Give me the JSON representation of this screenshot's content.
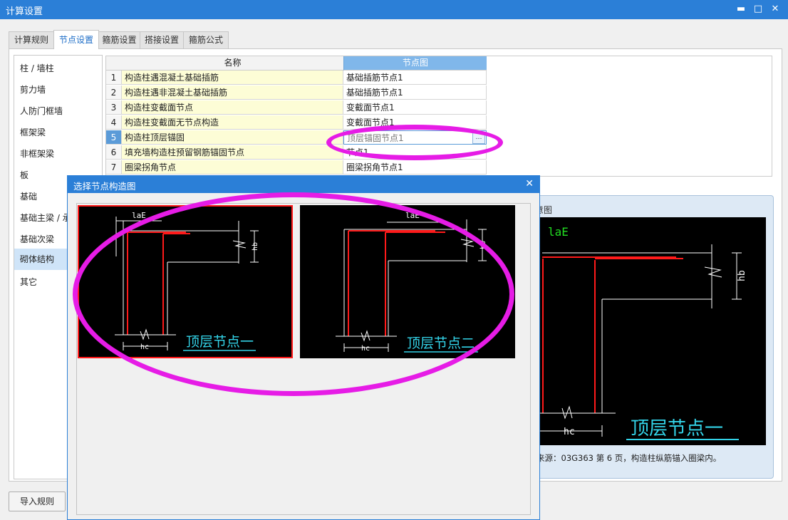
{
  "window": {
    "title": "计算设置",
    "minimize": "▬",
    "maximize": "□",
    "close": "✕"
  },
  "tabs": [
    "计算规则",
    "节点设置",
    "箍筋设置",
    "搭接设置",
    "箍筋公式"
  ],
  "active_tab": 1,
  "left_nav": [
    "柱 / 墙柱",
    "剪力墙",
    "人防门框墙",
    "框架梁",
    "非框架梁",
    "板",
    "基础",
    "基础主梁 / 承台梁",
    "基础次梁",
    "砌体结构",
    "其它"
  ],
  "selected_nav": 9,
  "grid": {
    "headers": {
      "name": "名称",
      "node": "节点图"
    },
    "rows": [
      {
        "no": "1",
        "name": "构造柱遇混凝土基础插筋",
        "node": "基础插筋节点1"
      },
      {
        "no": "2",
        "name": "构造柱遇非混凝土基础插筋",
        "node": "基础插筋节点1"
      },
      {
        "no": "3",
        "name": "构造柱变截面节点",
        "node": "变截面节点1"
      },
      {
        "no": "4",
        "name": "构造柱变截面无节点构造",
        "node": "变截面节点1"
      },
      {
        "no": "5",
        "name": "构造柱顶层锚固",
        "node": "顶层锚固节点1"
      },
      {
        "no": "6",
        "name": "填充墙构造柱预留钢筋锚固节点",
        "node": "节点1"
      },
      {
        "no": "7",
        "name": "圈梁拐角节点",
        "node": "圈梁拐角节点1"
      }
    ],
    "selected_row": 4,
    "ellipsis": "…"
  },
  "info_panel": {
    "title": "意图",
    "caption": "顶层节点一",
    "labels": {
      "lae": "laE",
      "hb": "hb",
      "hc": "hc"
    },
    "source": "来源：03G363 第 6 页，构造柱纵筋锚入圈梁内。"
  },
  "import_button": "导入规则",
  "dialog": {
    "title": "选择节点构造图",
    "close": "✕",
    "options": [
      {
        "caption": "顶层节点一",
        "selected": true
      },
      {
        "caption": "顶层节点二",
        "selected": false
      }
    ],
    "labels": {
      "lae": "laE",
      "hb": "hb",
      "hc": "hc"
    }
  },
  "colors": {
    "accent": "#2b7fd7",
    "highlight": "#e61ce6",
    "rebar": "#ff1a1a",
    "caption": "#33d3e8",
    "lae_big": "#22dd22"
  }
}
